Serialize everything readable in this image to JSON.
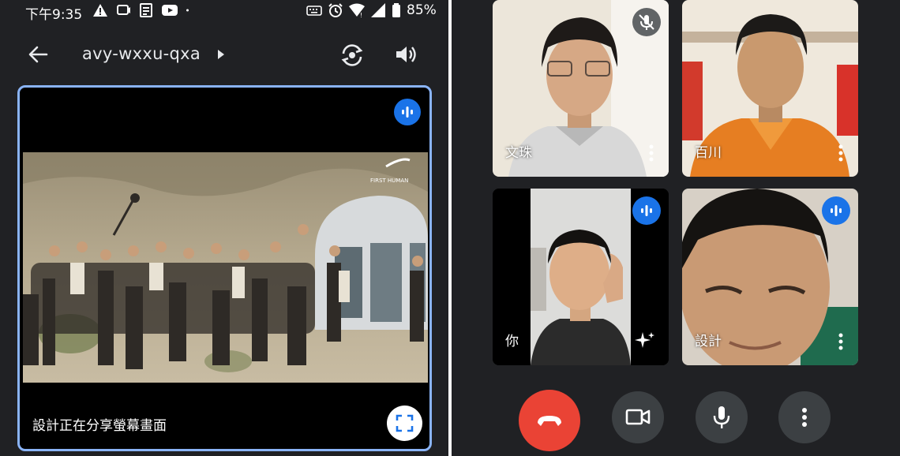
{
  "status_bar": {
    "time": "下午9:35",
    "battery": "85%",
    "icons": [
      "warning-icon",
      "cast-icon",
      "news-icon",
      "youtube-icon",
      "dot-icon",
      "keyboard-icon",
      "alarm-icon",
      "wifi-icon",
      "signal-icon",
      "battery-icon"
    ]
  },
  "top_bar": {
    "meeting_code": "avy-wxxu-qxa",
    "icons": [
      "back-arrow-icon",
      "caret-right-icon",
      "switch-camera-icon",
      "speaker-icon"
    ]
  },
  "share": {
    "caption": "設計正在分享螢幕畫面",
    "icons": [
      "audio-wave-icon",
      "fullscreen-icon"
    ]
  },
  "participants": [
    {
      "name": "文珠",
      "status": "muted"
    },
    {
      "name": "百川",
      "status": "none"
    },
    {
      "name": "你",
      "status": "speaking"
    },
    {
      "name": "設計",
      "status": "speaking"
    }
  ],
  "controls": [
    {
      "name": "end-call",
      "icon": "hang-up-icon",
      "color": "#ea4335"
    },
    {
      "name": "camera",
      "icon": "video-camera-icon",
      "color": "#3c4043"
    },
    {
      "name": "microphone",
      "icon": "microphone-icon",
      "color": "#3c4043"
    },
    {
      "name": "more-options",
      "icon": "more-vertical-icon",
      "color": "#3c4043"
    }
  ],
  "colors": {
    "background": "#202124",
    "active_speaker_border": "#8ab4f8",
    "speaking_badge": "#1a73e8",
    "end_call": "#ea4335"
  }
}
